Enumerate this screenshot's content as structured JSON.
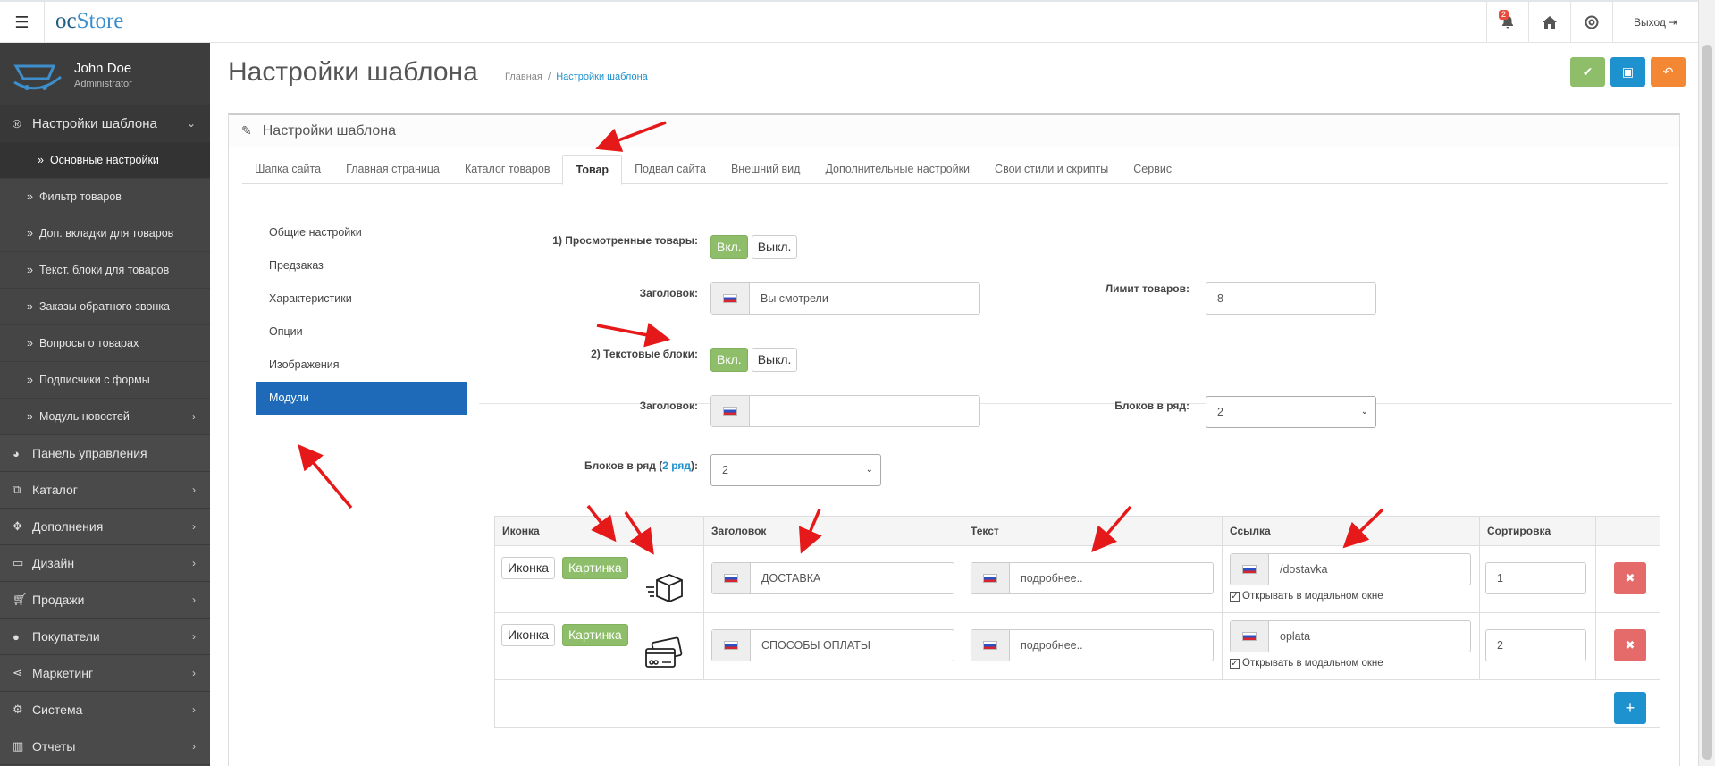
{
  "topbar": {
    "menu_icon": "hamburger-icon",
    "logo_oc": "oc",
    "logo_store": "Store",
    "notif_count": "2",
    "exit_label": "Выход"
  },
  "sidebar": {
    "user_name": "John Doe",
    "user_role": "Administrator",
    "active_section": "Настройки шаблона",
    "sub_items": [
      "Основные настройки",
      "Фильтр товаров",
      "Доп. вкладки для товаров",
      "Текст. блоки для товаров",
      "Заказы обратного звонка",
      "Вопросы о товарах",
      "Подписчики с формы",
      "Модуль новостей"
    ],
    "menu": [
      "Панель управления",
      "Каталог",
      "Дополнения",
      "Дизайн",
      "Продажи",
      "Покупатели",
      "Маркетинг",
      "Система",
      "Отчеты"
    ]
  },
  "header": {
    "title": "Настройки шаблона",
    "breadcrumb_home": "Главная",
    "breadcrumb_sep": "/",
    "breadcrumb_current": "Настройки шаблона",
    "colors": {
      "save": "#8fbe6a",
      "save2": "#1e91cf",
      "back": "#f38733"
    }
  },
  "panel": {
    "title": "Настройки шаблона",
    "tabs": [
      "Шапка сайта",
      "Главная страница",
      "Каталог товаров",
      "Товар",
      "Подвал сайта",
      "Внешний вид",
      "Дополнительные настройки",
      "Свои стили и скрипты",
      "Сервис"
    ],
    "subnav": [
      "Общие настройки",
      "Предзаказ",
      "Характеристики",
      "Опции",
      "Изображения",
      "Модули"
    ]
  },
  "form": {
    "viewed_label": "1) Просмотренные товары:",
    "on": "Вкл.",
    "off": "Выкл.",
    "heading_label": "Заголовок:",
    "viewed_heading": "Вы смотрели",
    "limit_label": "Лимит товаров:",
    "limit_value": "8",
    "text_blocks_label": "2) Текстовые блоки:",
    "text_heading": "",
    "per_row_label": "Блоков в ряд:",
    "per_row_value": "2",
    "per_row2_label_a": "Блоков в ряд (",
    "per_row2_link": "2 ряд",
    "per_row2_label_b": "):",
    "per_row2_value": "2"
  },
  "table": {
    "headers": [
      "Иконка",
      "Заголовок",
      "Текст",
      "Ссылка",
      "Сортировка"
    ],
    "icon_btn": "Иконка",
    "image_btn": "Картинка",
    "modal_label": "Открывать в модальном окне",
    "rows": [
      {
        "title": "ДОСТАВКА",
        "text": "подробнее..",
        "link": "/dostavka",
        "sort": "1",
        "image": "delivery-box-icon"
      },
      {
        "title": "СПОСОБЫ ОПЛАТЫ",
        "text": "подробнее..",
        "link": "oplata",
        "sort": "2",
        "image": "payment-card-icon"
      }
    ]
  }
}
